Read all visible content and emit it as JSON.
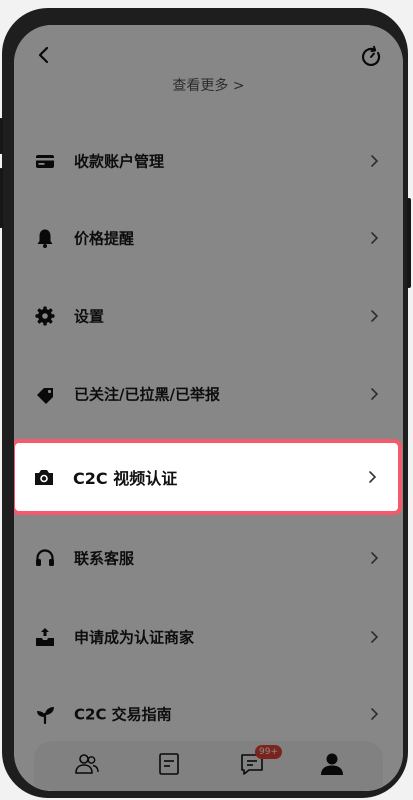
{
  "header": {
    "see_more": "查看更多 >"
  },
  "menu": [
    {
      "label": "收款账户管理",
      "icon": "card-icon"
    },
    {
      "label": "价格提醒",
      "icon": "bell-icon"
    },
    {
      "label": "设置",
      "icon": "gear-icon"
    },
    {
      "label": "已关注/已拉黑/已举报",
      "icon": "tag-icon"
    },
    {
      "label": "C2C 视频认证",
      "icon": "camera-icon",
      "highlighted": true
    },
    {
      "label": "联系客服",
      "icon": "headset-icon"
    },
    {
      "label": "申请成为认证商家",
      "icon": "merchant-upload-icon"
    },
    {
      "label": "C2C 交易指南",
      "icon": "sprout-icon"
    }
  ],
  "tabbar": {
    "tabs": [
      {
        "icon": "people-icon"
      },
      {
        "icon": "orders-icon"
      },
      {
        "icon": "messages-icon",
        "badge": "99+"
      },
      {
        "icon": "profile-icon",
        "active": true
      }
    ]
  },
  "colors": {
    "highlight_border": "#f45a6e",
    "badge": "#e8453c",
    "dim_overlay": "rgba(0,0,0,0.47)"
  }
}
